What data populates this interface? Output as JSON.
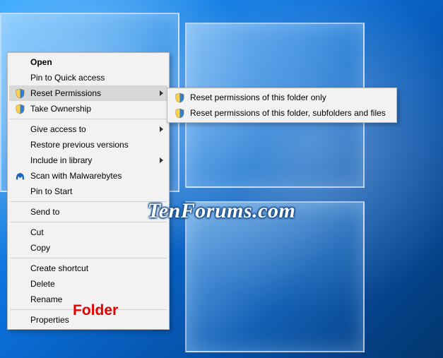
{
  "watermark": "TenForums.com",
  "annotation": "Folder",
  "icons": {
    "shield": "shield-icon",
    "malwarebytes": "malwarebytes-icon"
  },
  "menu1": {
    "open": "Open",
    "pin_quick": "Pin to Quick access",
    "reset_perm": "Reset Permissions",
    "take_owner": "Take Ownership",
    "give_access": "Give access to",
    "restore_prev": "Restore previous versions",
    "include_lib": "Include in library",
    "scan_mwb": "Scan with Malwarebytes",
    "pin_start": "Pin to Start",
    "send_to": "Send to",
    "cut": "Cut",
    "copy": "Copy",
    "create_shortcut": "Create shortcut",
    "delete": "Delete",
    "rename": "Rename",
    "properties": "Properties"
  },
  "menu2": {
    "reset_only": "Reset permissions of this folder only",
    "reset_all": "Reset permissions of this folder, subfolders and files"
  }
}
